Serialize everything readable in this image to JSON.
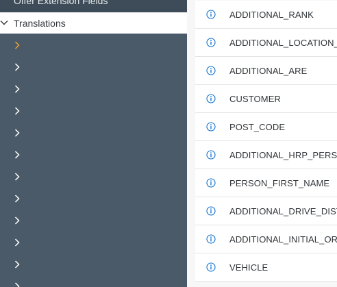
{
  "nav": {
    "previous_item_label": "Offer Extension Fields",
    "section": {
      "label": "Translations",
      "icon": "chevron-down-icon"
    },
    "items": [
      {
        "icon": "chevron-right-icon",
        "active": true
      },
      {
        "icon": "chevron-right-icon",
        "active": false
      },
      {
        "icon": "chevron-right-icon",
        "active": false
      },
      {
        "icon": "chevron-right-icon",
        "active": false
      },
      {
        "icon": "chevron-right-icon",
        "active": false
      },
      {
        "icon": "chevron-right-icon",
        "active": false
      },
      {
        "icon": "chevron-right-icon",
        "active": false
      },
      {
        "icon": "chevron-right-icon",
        "active": false
      },
      {
        "icon": "chevron-right-icon",
        "active": false
      },
      {
        "icon": "chevron-right-icon",
        "active": false
      },
      {
        "icon": "chevron-right-icon",
        "active": false
      },
      {
        "icon": "chevron-right-icon",
        "active": false
      }
    ]
  },
  "list": {
    "rows": [
      {
        "label": "ADDITIONAL_RANK",
        "icon": "info-icon"
      },
      {
        "label": "ADDITIONAL_LOCATION_",
        "icon": "info-icon"
      },
      {
        "label": "ADDITIONAL_ARE",
        "icon": "info-icon"
      },
      {
        "label": "CUSTOMER",
        "icon": "info-icon"
      },
      {
        "label": "POST_CODE",
        "icon": "info-icon"
      },
      {
        "label": "ADDITIONAL_HRP_PERSO",
        "icon": "info-icon"
      },
      {
        "label": "PERSON_FIRST_NAME",
        "icon": "info-icon"
      },
      {
        "label": "ADDITIONAL_DRIVE_DIST",
        "icon": "info-icon"
      },
      {
        "label": "ADDITIONAL_INITIAL_OR",
        "icon": "info-icon"
      },
      {
        "label": "VEHICLE",
        "icon": "info-icon"
      }
    ]
  },
  "colors": {
    "nav_background": "#4a5a68",
    "chevron_active": "#e8a23a",
    "chevron_default": "#ffffff",
    "info_icon": "#0a6ed1",
    "text": "#32363a"
  }
}
